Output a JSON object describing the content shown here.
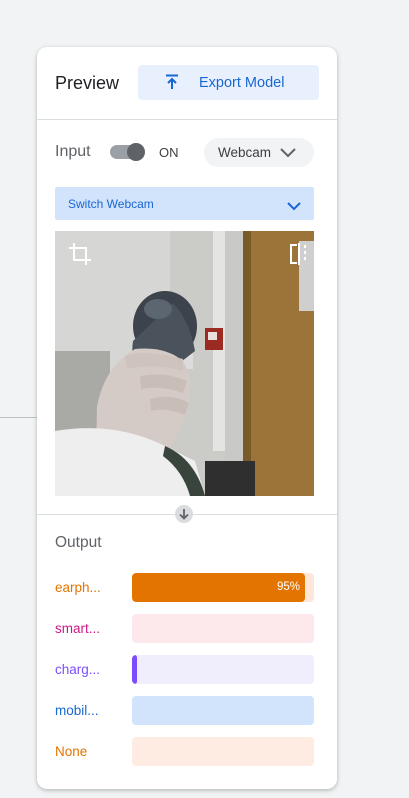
{
  "preview": {
    "title": "Preview",
    "export_label": "Export Model",
    "input_label": "Input",
    "toggle_state": "ON",
    "source_select": "Webcam",
    "switch_webcam_label": "Switch Webcam"
  },
  "output": {
    "title": "Output",
    "classes": [
      {
        "label": "earph...",
        "value": 95,
        "value_label": "95%",
        "color": "#e37400",
        "track": "#fde7d9"
      },
      {
        "label": "smart...",
        "value": 0,
        "value_label": "",
        "color": "#d01884",
        "track": "#fde8ec"
      },
      {
        "label": "charg...",
        "value": 3,
        "value_label": "",
        "color": "#7c4dff",
        "track": "#f0edfd"
      },
      {
        "label": "mobil...",
        "value": 0,
        "value_label": "",
        "color": "#1967d2",
        "track": "#d2e3fc"
      },
      {
        "label": "None",
        "value": 0,
        "value_label": "",
        "color": "#e37400",
        "track": "#feece3"
      }
    ]
  }
}
